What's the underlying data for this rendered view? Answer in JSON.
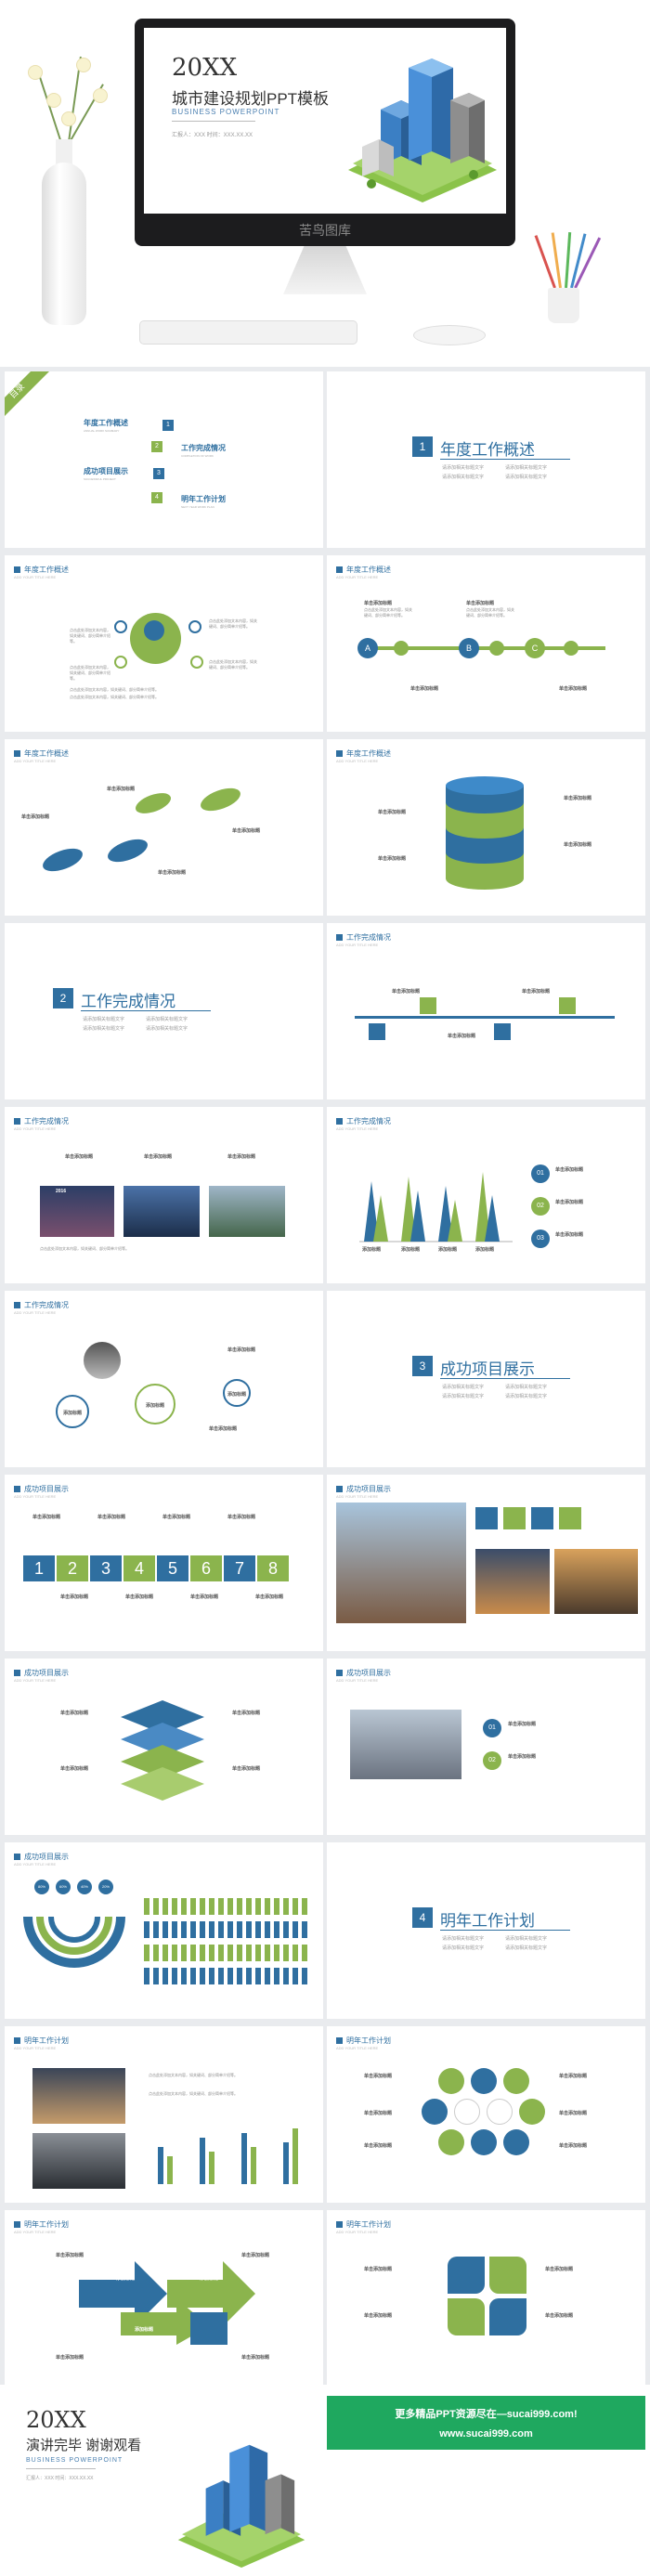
{
  "hero": {
    "year": "20XX",
    "title": "城市建设规划PPT模板",
    "subtitle": "BUSINESS POWERPOINT",
    "small": "汇报人：XXX 时间：XXX.XX.XX",
    "monitor_brand": "苦鸟图库"
  },
  "toc": {
    "badge": "目录",
    "items": [
      {
        "n": "1",
        "title": "年度工作概述",
        "sub": "ANNUAL WORK SUMMARY"
      },
      {
        "n": "2",
        "title": "工作完成情况",
        "sub": "COMPLETION OF WORK"
      },
      {
        "n": "3",
        "title": "成功项目展示",
        "sub": "SUCCESSFUL PROJECT"
      },
      {
        "n": "4",
        "title": "明年工作计划",
        "sub": "NEXT YEAR WORK PLAN"
      }
    ]
  },
  "sections": [
    {
      "n": "1",
      "title": "年度工作概述",
      "bullets": [
        "请添加相关标题文字",
        "请添加相关标题文字",
        "请添加相关标题文字",
        "请添加相关标题文字"
      ]
    },
    {
      "n": "2",
      "title": "工作完成情况",
      "bullets": [
        "请添加相关标题文字",
        "请添加相关标题文字",
        "请添加相关标题文字",
        "请添加相关标题文字"
      ]
    },
    {
      "n": "3",
      "title": "成功项目展示",
      "bullets": [
        "请添加相关标题文字",
        "请添加相关标题文字",
        "请添加相关标题文字",
        "请添加相关标题文字"
      ]
    },
    {
      "n": "4",
      "title": "明年工作计划",
      "bullets": [
        "请添加相关标题文字",
        "请添加相关标题文字",
        "请添加相关标题文字",
        "请添加相关标题文字"
      ]
    }
  ],
  "headers": {
    "s1": "年度工作概述",
    "s2": "工作完成情况",
    "s3": "成功项目展示",
    "s4": "明年工作计划",
    "sub": "ADD YOUR TITLE HERE"
  },
  "common": {
    "label": "单击添加标题",
    "filler": "点击此处添加文本内容，如关键词、部分简单介绍等。",
    "year_label": "2016"
  },
  "numbers": [
    "1",
    "2",
    "3",
    "4",
    "5",
    "6",
    "7",
    "8"
  ],
  "steps": [
    "01",
    "02",
    "03"
  ],
  "abc": [
    "A",
    "B",
    "C"
  ],
  "chart_label": "添加标题",
  "percents": [
    "80%",
    "60%",
    "40%",
    "20%"
  ],
  "footer": {
    "year": "20XX",
    "title": "演讲完毕  谢谢观看",
    "subtitle": "BUSINESS POWERPOINT",
    "small": "汇报人：XXX 时间：XXX.XX.XX",
    "promo_line1": "更多精品PPT资源尽在—sucai999.com!",
    "promo_line2": "www.sucai999.com"
  },
  "colors": {
    "blue": "#2f6fa0",
    "green": "#8bb44d"
  }
}
